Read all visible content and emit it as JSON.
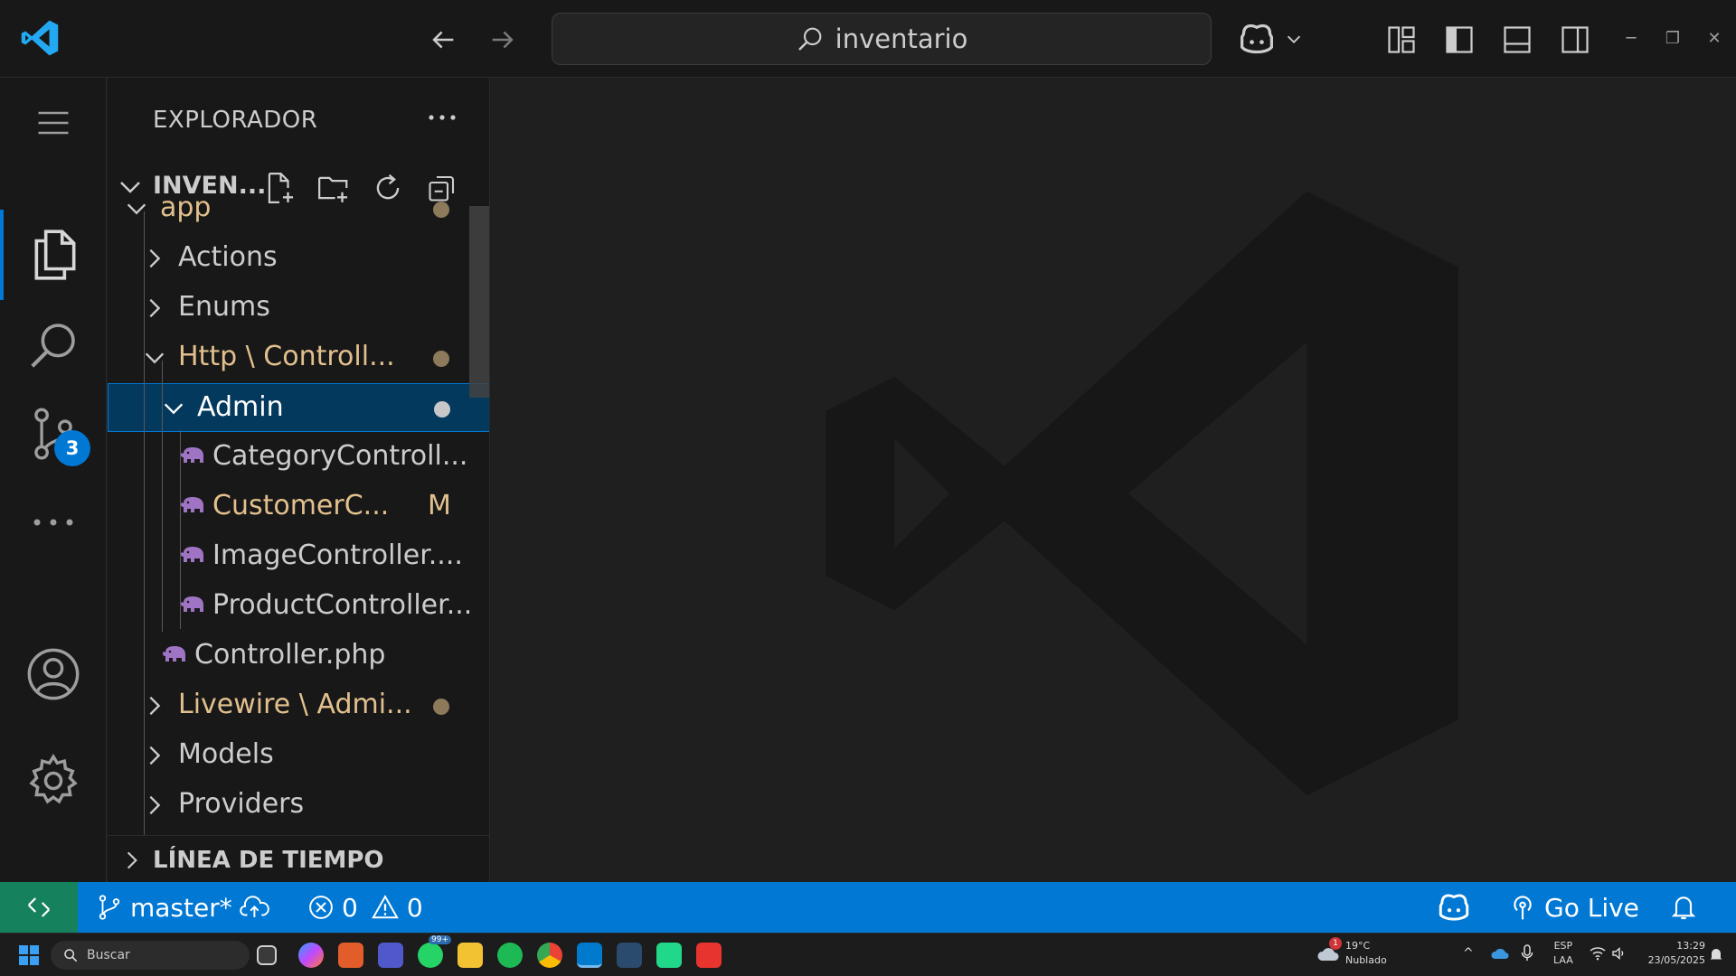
{
  "titlebar": {
    "search_text": "inventario"
  },
  "activitybar": {
    "scm_badge": "3"
  },
  "sidebar": {
    "title": "EXPLORADOR",
    "workspace": "INVEN...",
    "tree": [
      {
        "label": "app",
        "type": "folder",
        "expanded": true,
        "color": "#e2c08d",
        "dot": "#8c7a5a"
      },
      {
        "label": "Actions",
        "type": "folder",
        "expanded": false,
        "color": "#cccccc"
      },
      {
        "label": "Enums",
        "type": "folder",
        "expanded": false,
        "color": "#cccccc"
      },
      {
        "label": "Http \\ Controll...",
        "type": "folder",
        "expanded": true,
        "color": "#e2c08d",
        "dot": "#8c7a5a"
      },
      {
        "label": "Admin",
        "type": "folder",
        "expanded": true,
        "color": "#ffffff",
        "dot": "#c8c8c8",
        "selected": true
      },
      {
        "label": "CategoryControll...",
        "type": "php",
        "color": "#cccccc"
      },
      {
        "label": "CustomerC...",
        "type": "php",
        "color": "#e2c08d",
        "mark": "M"
      },
      {
        "label": "ImageController....",
        "type": "php",
        "color": "#cccccc"
      },
      {
        "label": "ProductController...",
        "type": "php",
        "color": "#cccccc"
      },
      {
        "label": "Controller.php",
        "type": "php",
        "color": "#cccccc"
      },
      {
        "label": "Livewire \\ Admi...",
        "type": "folder",
        "expanded": false,
        "color": "#e2c08d",
        "dot": "#8c7a5a"
      },
      {
        "label": "Models",
        "type": "folder",
        "expanded": false,
        "color": "#cccccc"
      },
      {
        "label": "Providers",
        "type": "folder",
        "expanded": false,
        "color": "#cccccc"
      }
    ],
    "timeline_label": "LÍNEA DE TIEMPO"
  },
  "statusbar": {
    "branch": "master*",
    "errors": "0",
    "warnings": "0",
    "go_live": "Go Live"
  },
  "taskbar": {
    "search_placeholder": "Buscar",
    "weather_temp": "19°C",
    "weather_desc": "Nublado",
    "weather_alert": "1",
    "lang_top": "ESP",
    "lang_bottom": "LAA",
    "time": "13:29",
    "date": "23/05/2025",
    "whatsapp_badge": "99+"
  },
  "colors": {
    "accent": "#0078d4",
    "remote": "#16825d",
    "modified": "#e2c08d",
    "php_icon": "#a074c4"
  }
}
